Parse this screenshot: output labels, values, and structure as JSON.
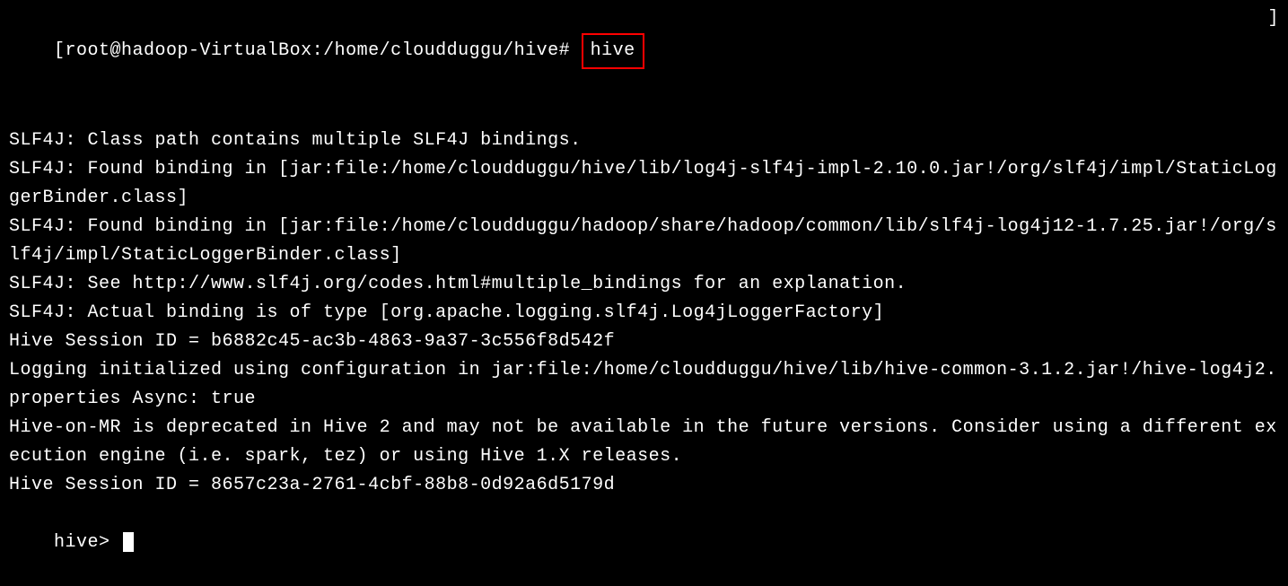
{
  "terminal": {
    "prompt_line": {
      "bracket_open": "[",
      "prompt": "root@hadoop-VirtualBox:/home/cloudduggu/hive#",
      "command": "hive",
      "bracket_close": "]"
    },
    "output_lines": [
      "SLF4J: Class path contains multiple SLF4J bindings.",
      "SLF4J: Found binding in [jar:file:/home/cloudduggu/hive/lib/log4j-slf4j-impl-2.10.0.jar!/org/slf4j/impl/StaticLoggerBinder.class]",
      "SLF4J: Found binding in [jar:file:/home/cloudduggu/hadoop/share/hadoop/common/lib/slf4j-log4j12-1.7.25.jar!/org/slf4j/impl/StaticLoggerBinder.class]",
      "SLF4J: See http://www.slf4j.org/codes.html#multiple_bindings for an explanation.",
      "SLF4J: Actual binding is of type [org.apache.logging.slf4j.Log4jLoggerFactory]",
      "Hive Session ID = b6882c45-ac3b-4863-9a37-3c556f8d542f",
      "",
      "Logging initialized using configuration in jar:file:/home/cloudduggu/hive/lib/hive-common-3.1.2.jar!/hive-log4j2.properties Async: true",
      "Hive-on-MR is deprecated in Hive 2 and may not be available in the future versions. Consider using a different execution engine (i.e. spark, tez) or using Hive 1.X releases.",
      "Hive Session ID = 8657c23a-2761-4cbf-88b8-0d92a6d5179d"
    ],
    "hive_prompt": "hive> "
  }
}
